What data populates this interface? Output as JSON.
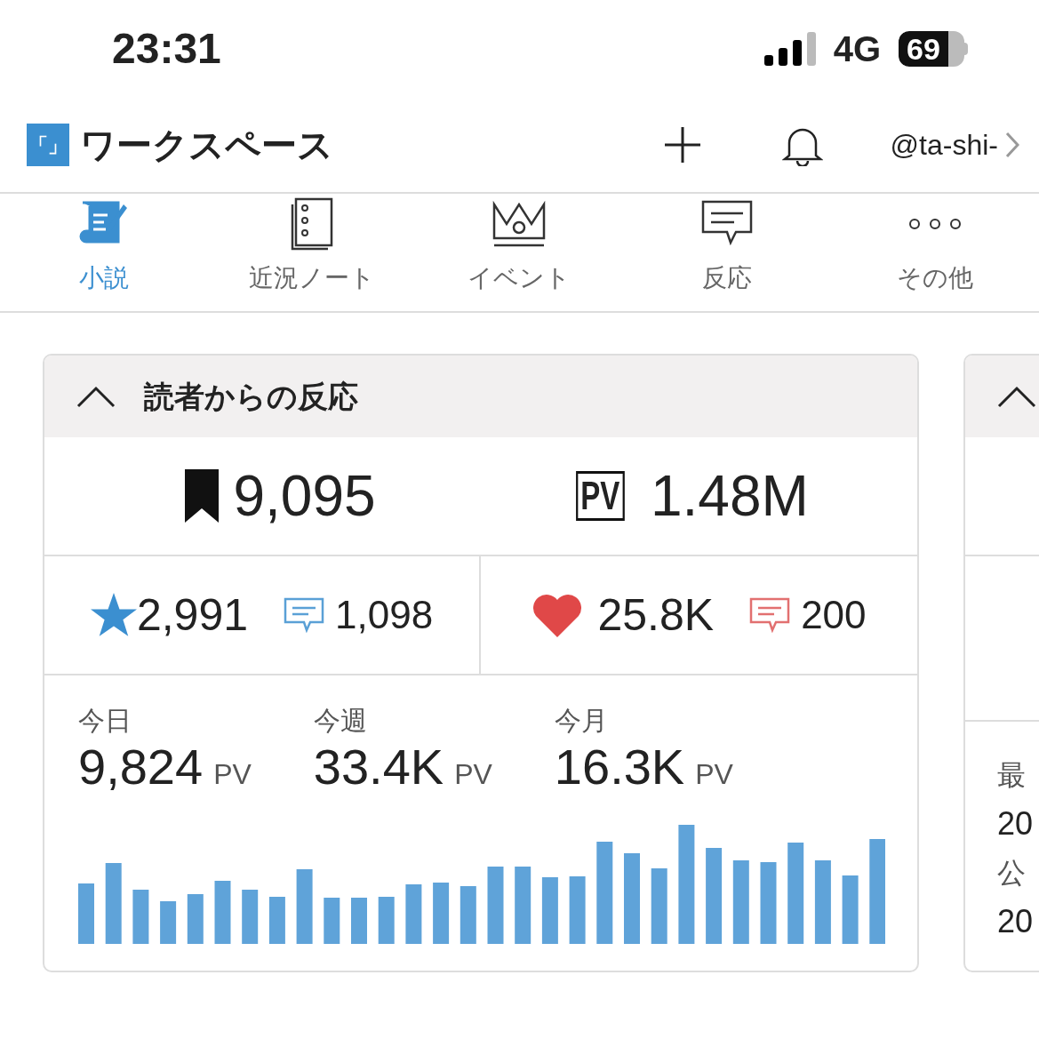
{
  "status_bar": {
    "time": "23:31",
    "network": "4G",
    "battery": "69"
  },
  "header": {
    "logo": "「」",
    "title": "ワークスペース",
    "account": "@ta-shi-"
  },
  "tabs": [
    {
      "label": "小説",
      "kind": "novel",
      "selected": true
    },
    {
      "label": "近況ノート",
      "kind": "notebook",
      "selected": false
    },
    {
      "label": "イベント",
      "kind": "crown",
      "selected": false
    },
    {
      "label": "反応",
      "kind": "comment",
      "selected": false
    },
    {
      "label": "その他",
      "kind": "more",
      "selected": false
    }
  ],
  "reactions_card": {
    "title": "読者からの反応",
    "expanded": true,
    "followers": "9,095",
    "pv_badge": "PV",
    "pv_total": "1.48M",
    "stars": "2,991",
    "reviews": "1,098",
    "hearts": "25.8K",
    "comments": "200",
    "periods": [
      {
        "label": "今日",
        "value": "9,824",
        "unit": "PV"
      },
      {
        "label": "今週",
        "value": "33.4K",
        "unit": "PV"
      },
      {
        "label": "今月",
        "value": "16.3K",
        "unit": "PV"
      }
    ]
  },
  "side_card": {
    "expanded": true,
    "lines": [
      "最",
      "20",
      "公",
      "20"
    ]
  }
}
